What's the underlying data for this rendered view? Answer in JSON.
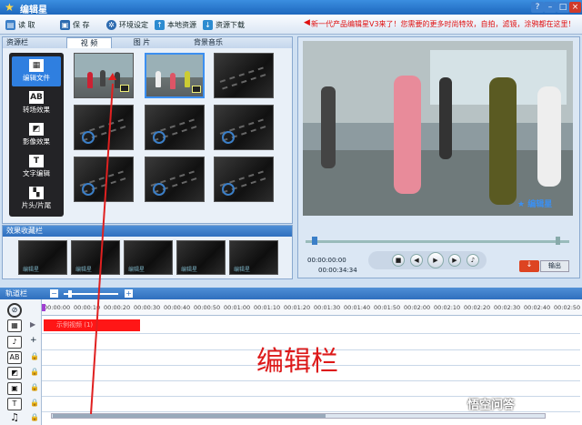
{
  "app": {
    "title": "编辑星"
  },
  "toolbar": {
    "read": "读 取",
    "save": "保 存",
    "env": "环境设定",
    "local": "本地资源",
    "download": "资源下载"
  },
  "promo": "新一代产品编辑星V3来了！您需要的更多时尚特效，自拍，滤镜，涂鸦都在这里！",
  "resource": {
    "panel_title": "资源栏",
    "tabs": [
      "视 频",
      "图 片",
      "背景音乐"
    ],
    "categories": [
      "编辑文件",
      "转场效果",
      "影像效果",
      "文字编辑",
      "片头/片尾"
    ]
  },
  "favorites": {
    "panel_title": "效果收藏栏",
    "thumb_label": "编辑星"
  },
  "preview": {
    "time_current": "00:00:00:00",
    "time_total": "00:00:34:34",
    "logo": "编辑星",
    "output_label": "输出"
  },
  "track": {
    "panel_title": "轨道栏",
    "ticks": [
      "00:00:00",
      "00:00:10",
      "00:00:20",
      "00:00:30",
      "00:00:40",
      "00:00:50",
      "00:01:00",
      "00:01:10",
      "00:01:20",
      "00:01:30",
      "00:01:40",
      "00:01:50",
      "00:02:00",
      "00:02:10",
      "00:02:20",
      "00:02:30",
      "00:02:40",
      "00:02:50"
    ],
    "clip_label": "示例视频 (1)",
    "area_label": "编辑栏"
  },
  "watermark": "悟空问答",
  "colors": {
    "accent": "#2f6fbe",
    "clip": "#ff1616",
    "label": "#dd1a1a"
  }
}
